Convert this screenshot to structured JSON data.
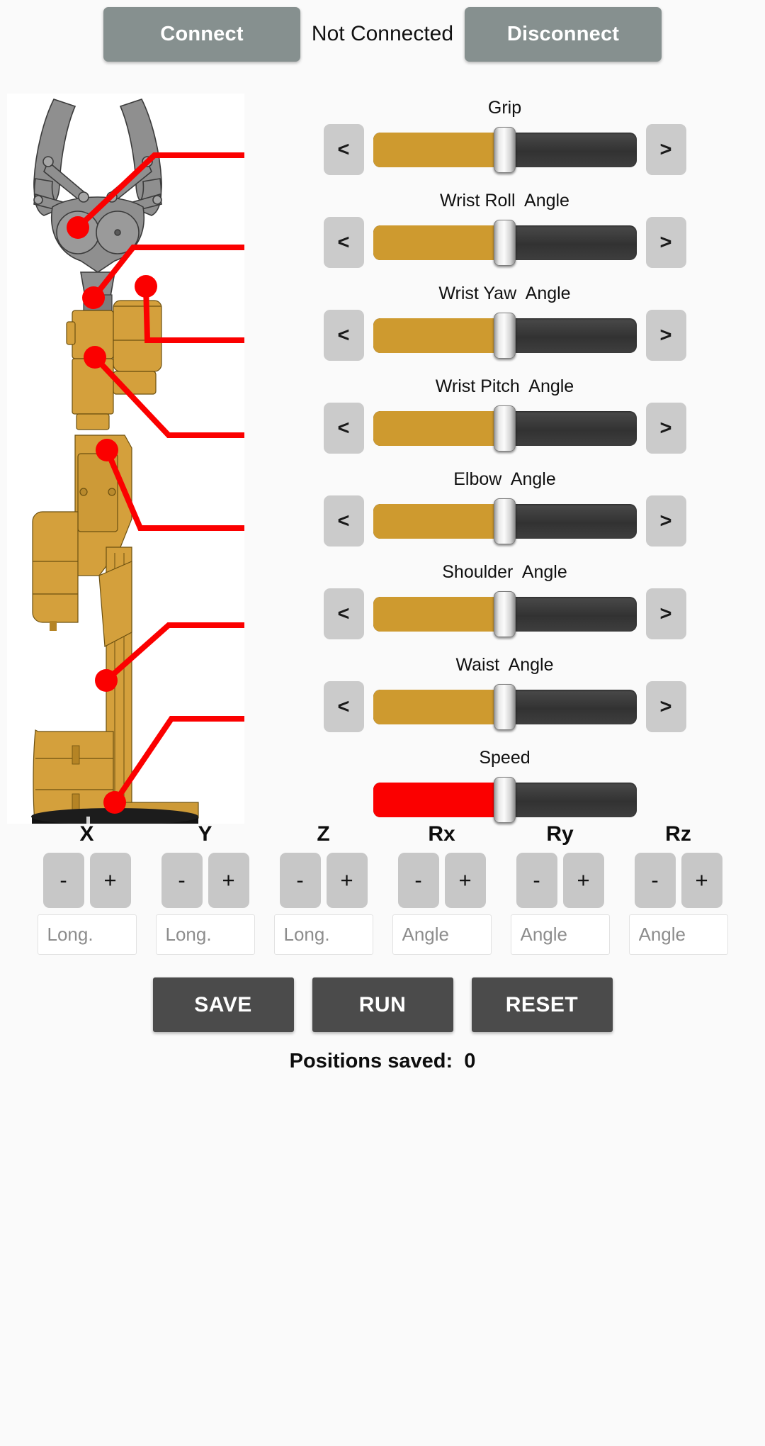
{
  "connection": {
    "connect_label": "Connect",
    "disconnect_label": "Disconnect",
    "status": "Not Connected"
  },
  "arm_image": {
    "alt": "robot-arm-diagram",
    "gripper_color": "#8f8f8f",
    "body_color": "#d4a03c",
    "base_color": "#111111",
    "leader_color": "#fb0000",
    "joint_count": 7
  },
  "sliders": [
    {
      "label": "Grip",
      "value": 50,
      "fill": "#ce9a2f",
      "left_arrow": "<",
      "right_arrow": ">",
      "has_arrows": true
    },
    {
      "label": "Wrist Roll  Angle",
      "value": 50,
      "fill": "#ce9a2f",
      "left_arrow": "<",
      "right_arrow": ">",
      "has_arrows": true
    },
    {
      "label": "Wrist Yaw  Angle",
      "value": 50,
      "fill": "#ce9a2f",
      "left_arrow": "<",
      "right_arrow": ">",
      "has_arrows": true
    },
    {
      "label": "Wrist Pitch  Angle",
      "value": 50,
      "fill": "#ce9a2f",
      "left_arrow": "<",
      "right_arrow": ">",
      "has_arrows": true
    },
    {
      "label": "Elbow  Angle",
      "value": 50,
      "fill": "#ce9a2f",
      "left_arrow": "<",
      "right_arrow": ">",
      "has_arrows": true
    },
    {
      "label": "Shoulder  Angle",
      "value": 50,
      "fill": "#ce9a2f",
      "left_arrow": "<",
      "right_arrow": ">",
      "has_arrows": true
    },
    {
      "label": "Waist  Angle",
      "value": 50,
      "fill": "#ce9a2f",
      "left_arrow": "<",
      "right_arrow": ">",
      "has_arrows": true
    },
    {
      "label": "Speed",
      "value": 50,
      "fill": "#fb0000",
      "left_arrow": "",
      "right_arrow": "",
      "has_arrows": false
    }
  ],
  "coordinates": {
    "minus_label": "-",
    "plus_label": "+",
    "axes": [
      {
        "name": "X",
        "placeholder": "Long.",
        "value": ""
      },
      {
        "name": "Y",
        "placeholder": "Long.",
        "value": ""
      },
      {
        "name": "Z",
        "placeholder": "Long.",
        "value": ""
      },
      {
        "name": "Rx",
        "placeholder": "Angle",
        "value": ""
      },
      {
        "name": "Ry",
        "placeholder": "Angle",
        "value": ""
      },
      {
        "name": "Rz",
        "placeholder": "Angle",
        "value": ""
      }
    ]
  },
  "actions": {
    "save_label": "SAVE",
    "run_label": "RUN",
    "reset_label": "RESET"
  },
  "footer": {
    "positions_saved": "Positions saved:  0"
  }
}
